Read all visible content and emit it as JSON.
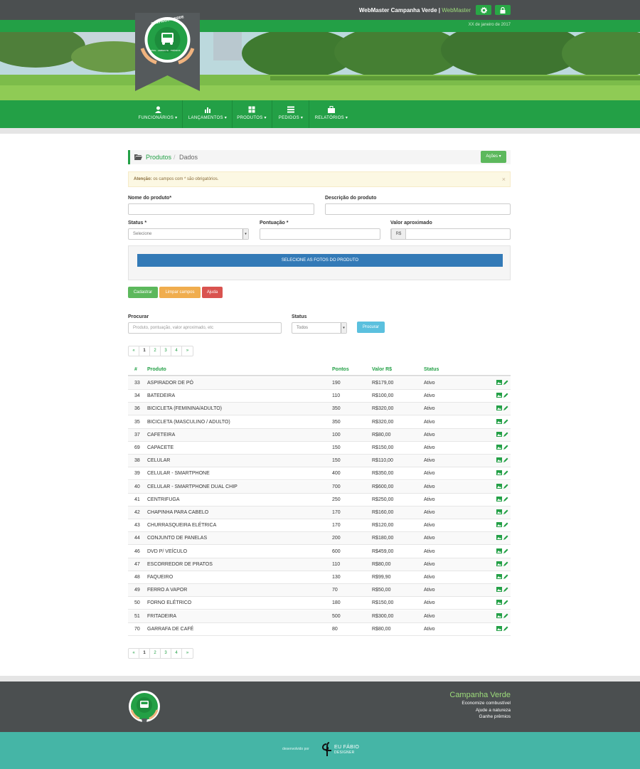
{
  "topbar": {
    "user_name": "WebMaster Campanha Verde",
    "separator": "|",
    "user_role": "WebMaster",
    "date": "XX de janeiro de 2017"
  },
  "logo": {
    "ring_text": "CAMPANHA VERDE",
    "sub_text": "SAÚDE · AMBIENTE · PRÊMIOS"
  },
  "nav": [
    {
      "label": "FUNCIONÁRIOS ▾",
      "icon": "user-icon"
    },
    {
      "label": "LANÇAMENTOS ▾",
      "icon": "bar-chart-icon"
    },
    {
      "label": "PRODUTOS ▾",
      "icon": "gift-icon"
    },
    {
      "label": "PEDIDOS ▾",
      "icon": "list-icon"
    },
    {
      "label": "RELATÓRIOS ▾",
      "icon": "briefcase-icon"
    }
  ],
  "breadcrumb": {
    "item1": "Produtos",
    "separator": "/",
    "item2": "Dados",
    "actions_label": "Ações ▾"
  },
  "alert": {
    "strong": "Atenção:",
    "text": " os campos com * são obrigatórios.",
    "close": "×"
  },
  "form": {
    "name_label": "Nome do produto*",
    "desc_label": "Descrição do produto",
    "status_label": "Status *",
    "status_value": "Selecione",
    "points_label": "Pontuação *",
    "value_label": "Valor aproximado",
    "currency": "R$",
    "photos_button": "SELECIONE AS FOTOS DO PRODUTO",
    "btn_save": "Cadastrar",
    "btn_clear": "Limpar campos",
    "btn_help": "Ajuda"
  },
  "search": {
    "label": "Procurar",
    "placeholder": "Produto, pontuação, valor aproximado, etc",
    "status_label": "Status",
    "status_value": "Todos",
    "button": "Procurar"
  },
  "pagination": [
    "«",
    "1",
    "2",
    "3",
    "4",
    "»"
  ],
  "table": {
    "headers": [
      "#",
      "Produto",
      "Pontos",
      "Valor R$",
      "Status"
    ],
    "rows": [
      [
        "33",
        "ASPIRADOR DE PÓ",
        "190",
        "R$179,00",
        "Ativo"
      ],
      [
        "34",
        "BATEDEIRA",
        "110",
        "R$100,00",
        "Ativo"
      ],
      [
        "36",
        "BICICLETA (FEMININA/ADULTO)",
        "350",
        "R$320,00",
        "Ativo"
      ],
      [
        "35",
        "BICICLETA (MASCULINO / ADULTO)",
        "350",
        "R$320,00",
        "Ativo"
      ],
      [
        "37",
        "CAFETEIRA",
        "100",
        "R$80,00",
        "Ativo"
      ],
      [
        "69",
        "CAPACETE",
        "150",
        "R$150,00",
        "Ativo"
      ],
      [
        "38",
        "CELULAR",
        "150",
        "R$110,00",
        "Ativo"
      ],
      [
        "39",
        "CELULAR - SMARTPHONE",
        "400",
        "R$350,00",
        "Ativo"
      ],
      [
        "40",
        "CELULAR - SMARTPHONE DUAL CHIP",
        "700",
        "R$600,00",
        "Ativo"
      ],
      [
        "41",
        "CENTRIFUGA",
        "250",
        "R$250,00",
        "Ativo"
      ],
      [
        "42",
        "CHAPINHA PARA CABELO",
        "170",
        "R$160,00",
        "Ativo"
      ],
      [
        "43",
        "CHURRASQUEIRA ELÉTRICA",
        "170",
        "R$120,00",
        "Ativo"
      ],
      [
        "44",
        "CONJUNTO DE PANELAS",
        "200",
        "R$180,00",
        "Ativo"
      ],
      [
        "46",
        "DVD P/ VEÍCULO",
        "600",
        "R$459,00",
        "Ativo"
      ],
      [
        "47",
        "ESCORREDOR DE PRATOS",
        "110",
        "R$80,00",
        "Ativo"
      ],
      [
        "48",
        "FAQUEIRO",
        "130",
        "R$99,90",
        "Ativo"
      ],
      [
        "49",
        "FERRO A VAPOR",
        "70",
        "R$50,00",
        "Ativo"
      ],
      [
        "50",
        "FORNO ELÉTRICO",
        "180",
        "R$150,00",
        "Ativo"
      ],
      [
        "51",
        "FRITADEIRA",
        "500",
        "R$300,00",
        "Ativo"
      ],
      [
        "70",
        "GARRAFA DE CAFÉ",
        "80",
        "R$80,00",
        "Ativo"
      ]
    ]
  },
  "footer": {
    "brand": "Campanha Verde",
    "lines": [
      "Economize combustível",
      "Ajude a natureza",
      "Ganhe prêmios"
    ],
    "dev_label": "desenvolvido por",
    "dev_name1": "EU FÁBIO",
    "dev_name2": "DESIGNER"
  },
  "colors": {
    "green": "#23a046",
    "dark": "#4b4f50",
    "teal": "#45b5a6",
    "blue": "#337ab7"
  }
}
